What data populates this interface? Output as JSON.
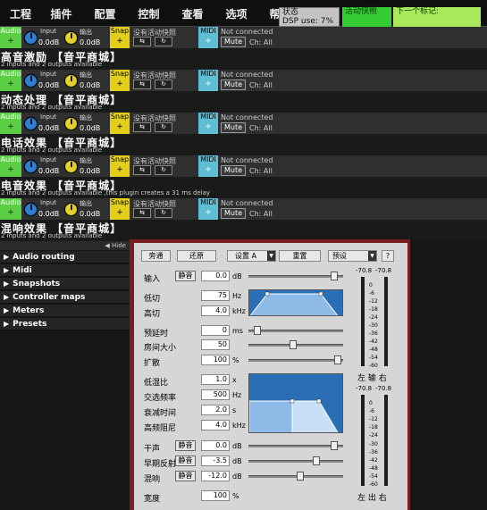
{
  "menu": {
    "items": [
      "工程",
      "插件",
      "配置",
      "控制",
      "查看",
      "选项",
      "帮助"
    ]
  },
  "status": {
    "dsp_label": "状态",
    "dsp_usage": "DSP use: 7%",
    "remote_label": "活动快照",
    "next_label": "下一个标记:"
  },
  "strips": [
    {
      "audio_label": "Audio",
      "input_label": "Input",
      "output_label": "输出",
      "input_db": "0.0dB",
      "output_db": "0.0dB",
      "snap_label": "Snap",
      "snap_text": "没有活动快照",
      "midi_label": "MIDI",
      "midi_status": "Not connected",
      "mute_label": "Mute",
      "channel": "Ch: All",
      "name": "高音激励 【音平商城】",
      "io_text": "2 inputs and 2 outputs available"
    },
    {
      "audio_label": "Audio",
      "input_label": "Input",
      "output_label": "输出",
      "input_db": "0.0dB",
      "output_db": "0.0dB",
      "snap_label": "Snap",
      "snap_text": "没有活动快照",
      "midi_label": "MIDI",
      "midi_status": "Not connected",
      "mute_label": "Mute",
      "channel": "Ch: All",
      "name": "动态处理 【音平商城】",
      "io_text": "2 inputs and 2 outputs available"
    },
    {
      "audio_label": "Audio",
      "input_label": "Input",
      "output_label": "输出",
      "input_db": "0.0dB",
      "output_db": "0.0dB",
      "snap_label": "Snap",
      "snap_text": "没有活动快照",
      "midi_label": "MIDI",
      "midi_status": "Not connected",
      "mute_label": "Mute",
      "channel": "Ch: All",
      "name": "电话效果 【音平商城】",
      "io_text": "2 inputs and 2 outputs available"
    },
    {
      "audio_label": "Audio",
      "input_label": "Input",
      "output_label": "输出",
      "input_db": "0.0dB",
      "output_db": "0.0dB",
      "snap_label": "Snap",
      "snap_text": "没有活动快照",
      "midi_label": "MIDI",
      "midi_status": "Not connected",
      "mute_label": "Mute",
      "channel": "Ch: All",
      "name": "电音效果 【音平商城】",
      "io_text": "2 inputs and 2 outputs available ,this plugin creates a 31 ms delay"
    },
    {
      "audio_label": "Audio",
      "input_label": "Input",
      "output_label": "输出",
      "input_db": "0.0dB",
      "output_db": "0.0dB",
      "snap_label": "Snap",
      "snap_text": "没有活动快照",
      "midi_label": "MIDI",
      "midi_status": "Not connected",
      "mute_label": "Mute",
      "channel": "Ch: All",
      "name": "混响效果 【音平商城】",
      "io_text": "2 inputs and 2 outputs available"
    }
  ],
  "side_panel": {
    "hide_label": "Hide",
    "items": [
      "Audio routing",
      "Midi",
      "Snapshots",
      "Controller maps",
      "Meters",
      "Presets"
    ]
  },
  "editor": {
    "top_buttons": {
      "bypass": "旁通",
      "restore": "还原",
      "setting": "设置 A",
      "reset": "重置",
      "preset": "预设",
      "help": "?"
    },
    "params": {
      "input": {
        "label": "输入",
        "mute": "静音",
        "value": "0.0",
        "unit": "dB"
      },
      "low_cut": {
        "label": "低切",
        "value": "75",
        "unit": "Hz"
      },
      "high_cut": {
        "label": "高切",
        "value": "4.0",
        "unit": "kHz"
      },
      "predelay": {
        "label": "预延时",
        "value": "0",
        "unit": "ms"
      },
      "room_size": {
        "label": "房间大小",
        "value": "50",
        "unit": ""
      },
      "diffusion": {
        "label": "扩散",
        "value": "100",
        "unit": "%"
      },
      "low_ratio": {
        "label": "低湿比",
        "value": "1.0",
        "unit": "x"
      },
      "crossover": {
        "label": "交选频率",
        "value": "500",
        "unit": "Hz"
      },
      "decay": {
        "label": "衰减时间",
        "value": "2.0",
        "unit": "s"
      },
      "hf_damp": {
        "label": "高频阻尼",
        "value": "4.0",
        "unit": "kHz"
      },
      "dry": {
        "label": "干声",
        "mute": "静音",
        "value": "0.0",
        "unit": "dB"
      },
      "early": {
        "label": "早期反射",
        "mute": "静音",
        "value": "-3.5",
        "unit": "dB"
      },
      "reverb": {
        "label": "混响",
        "mute": "静音",
        "value": "-12.0",
        "unit": "dB"
      },
      "width": {
        "label": "宽度",
        "value": "100",
        "unit": "%"
      }
    },
    "meters": {
      "in_peak_l": "-70.8",
      "in_peak_r": "-70.8",
      "in_label": "左 输 右",
      "out_peak_l": "-70.8",
      "out_peak_r": "-70.8",
      "out_label": "左 出 右",
      "scale": [
        "0",
        "-6",
        "-12",
        "-18",
        "-24",
        "-30",
        "-36",
        "-42",
        "-48",
        "-54",
        "-60"
      ]
    }
  }
}
